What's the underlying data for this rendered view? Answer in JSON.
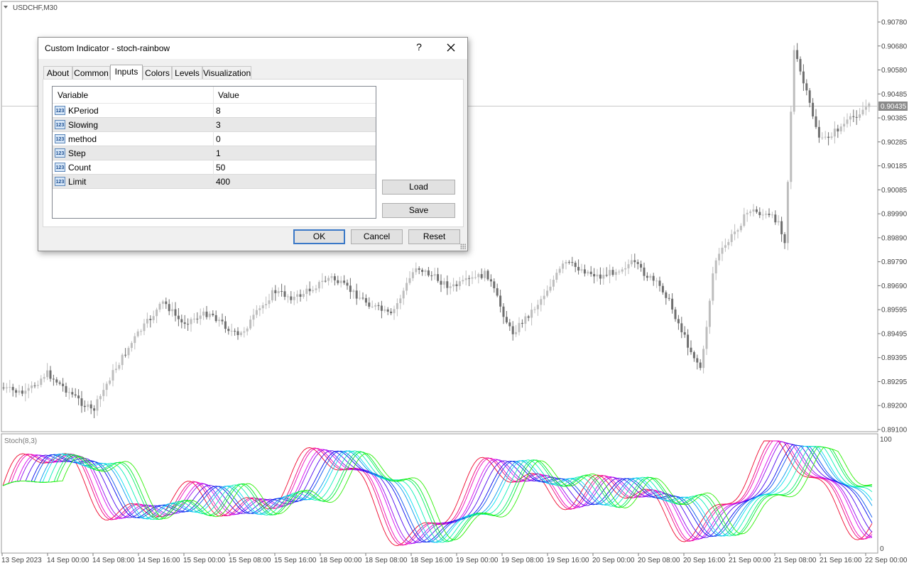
{
  "chart": {
    "symbol": "USDCHF,M30",
    "current_price": "0.90435",
    "price_labels": [
      "0.90780",
      "0.90680",
      "0.90580",
      "0.90485",
      "0.90385",
      "0.90285",
      "0.90185",
      "0.90085",
      "0.89990",
      "0.89890",
      "0.89790",
      "0.89690",
      "0.89595",
      "0.89495",
      "0.89395",
      "0.89295",
      "0.89200",
      "0.89100"
    ],
    "indicator_label": "Stoch(8,3)",
    "indicator_levels": [
      "100",
      "0"
    ],
    "time_labels": [
      "13 Sep 2023",
      "14 Sep 00:00",
      "14 Sep 08:00",
      "14 Sep 16:00",
      "15 Sep 00:00",
      "15 Sep 08:00",
      "15 Sep 16:00",
      "18 Sep 00:00",
      "18 Sep 08:00",
      "18 Sep 16:00",
      "19 Sep 00:00",
      "19 Sep 08:00",
      "19 Sep 16:00",
      "20 Sep 00:00",
      "20 Sep 08:00",
      "20 Sep 16:00",
      "21 Sep 00:00",
      "21 Sep 08:00",
      "21 Sep 16:00",
      "22 Sep 00:00"
    ],
    "colors": {
      "bull": "#bdbdbd",
      "bear": "#6e6e6e",
      "price_tag": "#8a8a8a",
      "grid": "#c0c0c0"
    }
  },
  "dialog": {
    "title": "Custom Indicator - stoch-rainbow",
    "help_label": "?",
    "tabs": [
      "About",
      "Common",
      "Inputs",
      "Colors",
      "Levels",
      "Visualization"
    ],
    "active_tab": "Inputs",
    "columns": {
      "variable": "Variable",
      "value": "Value"
    },
    "rows": [
      {
        "icon": "123",
        "name": "KPeriod",
        "value": "8"
      },
      {
        "icon": "123",
        "name": "Slowing",
        "value": "3"
      },
      {
        "icon": "123",
        "name": "method",
        "value": "0"
      },
      {
        "icon": "123",
        "name": "Step",
        "value": "1"
      },
      {
        "icon": "123",
        "name": "Count",
        "value": "50"
      },
      {
        "icon": "123",
        "name": "Limit",
        "value": "400"
      }
    ],
    "buttons": {
      "load": "Load",
      "save": "Save",
      "ok": "OK",
      "cancel": "Cancel",
      "reset": "Reset"
    },
    "icon_names": {
      "close": "close-icon",
      "param": "int-param-icon",
      "grip": "resize-grip-icon"
    }
  }
}
